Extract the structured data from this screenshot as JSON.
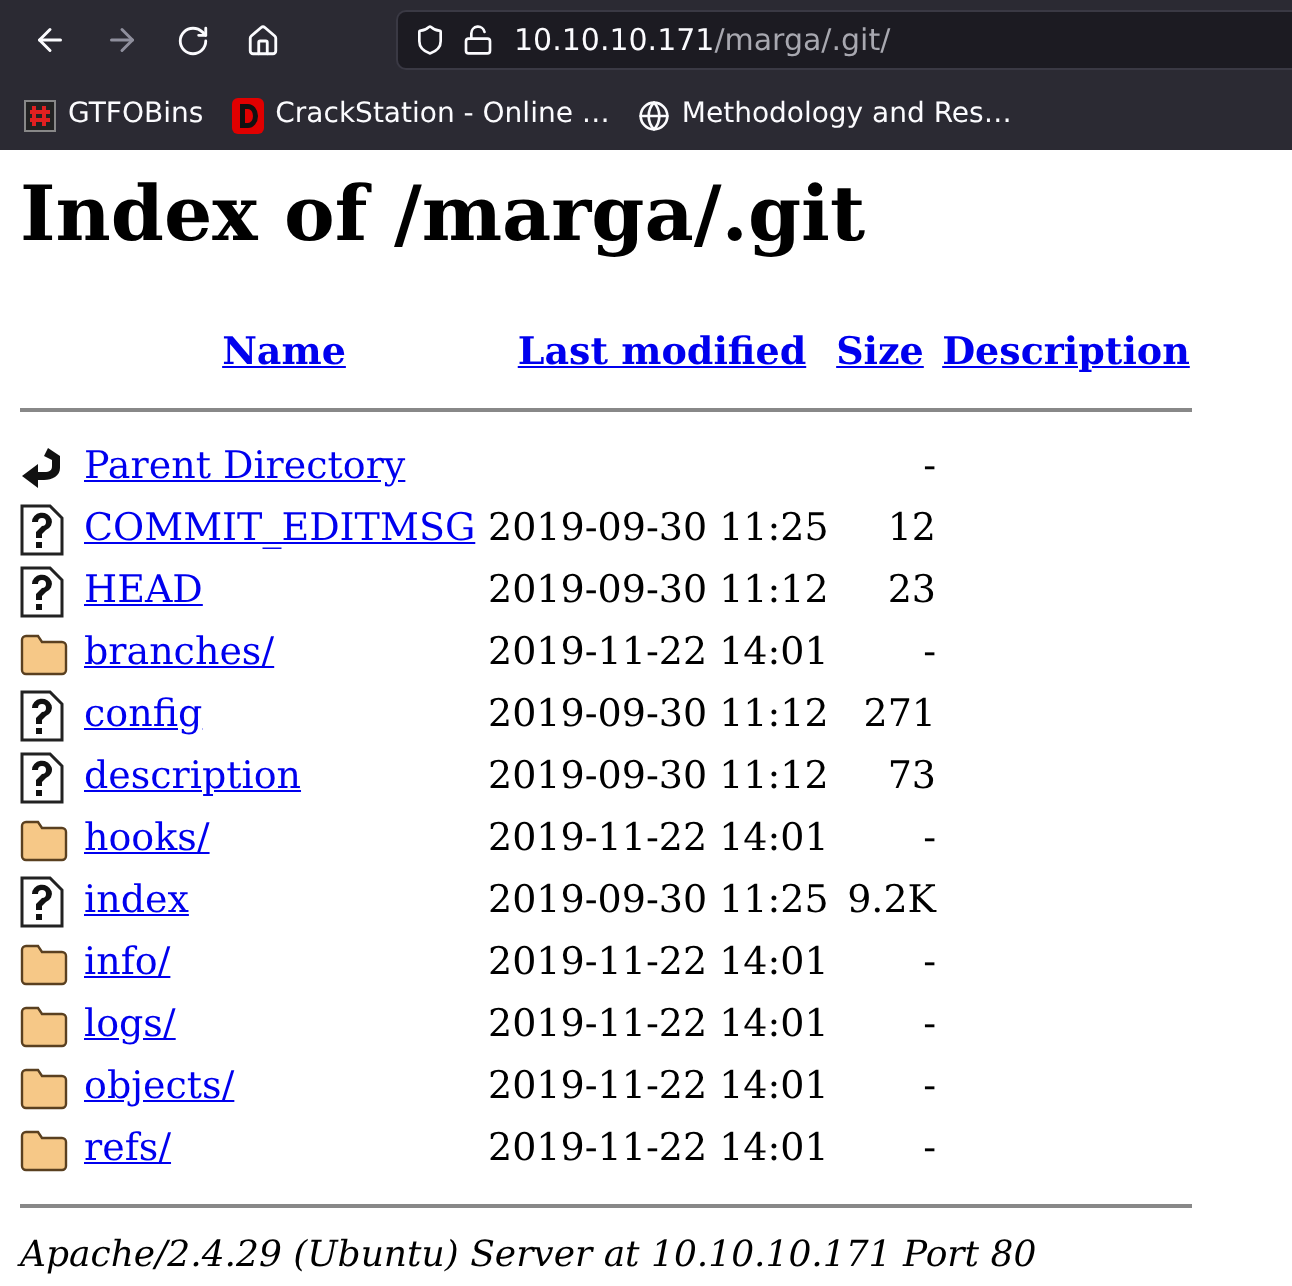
{
  "toolbar": {
    "url_host": "10.10.10.171",
    "url_path": "/marga/.git/"
  },
  "bookmarks": [
    {
      "label": "GTFOBins",
      "kind": "hash"
    },
    {
      "label": "CrackStation - Online …",
      "kind": "d"
    },
    {
      "label": "Methodology and Res…",
      "kind": "globe"
    }
  ],
  "page": {
    "title": "Index of /marga/.git",
    "columns": [
      "Name",
      "Last modified",
      "Size",
      "Description"
    ],
    "rows": [
      {
        "kind": "parent",
        "name": "Parent Directory",
        "modified": "",
        "size": "-"
      },
      {
        "kind": "file",
        "name": "COMMIT_EDITMSG",
        "modified": "2019-09-30 11:25",
        "size": "12"
      },
      {
        "kind": "file",
        "name": "HEAD",
        "modified": "2019-09-30 11:12",
        "size": "23"
      },
      {
        "kind": "folder",
        "name": "branches/",
        "modified": "2019-11-22 14:01",
        "size": "-"
      },
      {
        "kind": "file",
        "name": "config",
        "modified": "2019-09-30 11:12",
        "size": "271"
      },
      {
        "kind": "file",
        "name": "description",
        "modified": "2019-09-30 11:12",
        "size": "73"
      },
      {
        "kind": "folder",
        "name": "hooks/",
        "modified": "2019-11-22 14:01",
        "size": "-"
      },
      {
        "kind": "file",
        "name": "index",
        "modified": "2019-09-30 11:25",
        "size": "9.2K"
      },
      {
        "kind": "folder",
        "name": "info/",
        "modified": "2019-11-22 14:01",
        "size": "-"
      },
      {
        "kind": "folder",
        "name": "logs/",
        "modified": "2019-11-22 14:01",
        "size": "-"
      },
      {
        "kind": "folder",
        "name": "objects/",
        "modified": "2019-11-22 14:01",
        "size": "-"
      },
      {
        "kind": "folder",
        "name": "refs/",
        "modified": "2019-11-22 14:01",
        "size": "-"
      }
    ],
    "footer": "Apache/2.4.29 (Ubuntu) Server at 10.10.10.171 Port 80"
  }
}
